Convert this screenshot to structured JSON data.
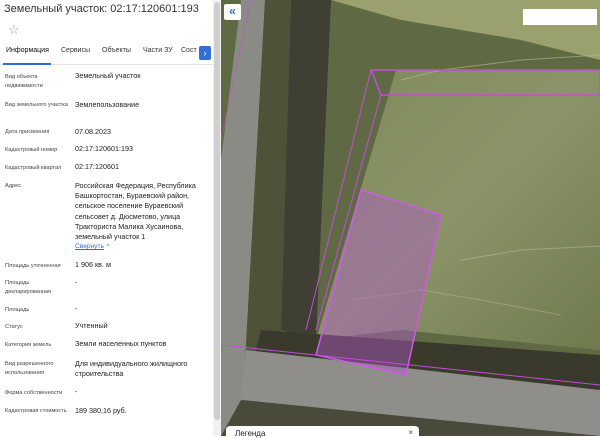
{
  "title": "Земельный участок: 02:17:120601:193",
  "tabs": [
    "Информация",
    "Сервисы",
    "Объекты",
    "Части ЗУ",
    "Сост"
  ],
  "fields": [
    {
      "label": "Вид объекта недвижимости",
      "value": "Земельный участок"
    },
    {
      "label": "Вид земельного участка",
      "value": "Землепользование"
    },
    {
      "label": "Дата присвоения",
      "value": "07.08.2023"
    },
    {
      "label": "Кадастровый номер",
      "value": "02:17:120601:193"
    },
    {
      "label": "Кадастровый квартал",
      "value": "02:17:120601"
    },
    {
      "label": "Адрес",
      "value": "Российская Федерация, Республика Башкортостан, Бураевский район, сельское поселение Бураевский сельсовет д. Дюсметово, улица Тракториста Малика Хусаинова, земельный участок 1"
    },
    {
      "label": "Площадь уточненная",
      "value": "1 906 кв. м"
    },
    {
      "label": "Площадь декларированная",
      "value": "-"
    },
    {
      "label": "Площадь",
      "value": "-"
    },
    {
      "label": "Статус",
      "value": "Учтенный"
    },
    {
      "label": "Категория земель",
      "value": "Земли населенных пунктов"
    },
    {
      "label": "Вид разрешенного использования",
      "value": "Для индивидуального жилищного строительства"
    },
    {
      "label": "Форма собственности",
      "value": "-"
    },
    {
      "label": "Кадастровая стоимость",
      "value": "189 380,16 руб."
    }
  ],
  "collapse_link": "Свернуть",
  "map": {
    "collapse_glyph": "«",
    "bottom_card_title": "Легенда",
    "close_glyph": "×"
  },
  "icons": {
    "favorite": "star-icon",
    "next_tab": "chevron-right-icon",
    "collapse": "double-chevron-left-icon"
  },
  "colors": {
    "accent": "#2d6cdf",
    "parcel_outline": "#c04fd6"
  }
}
